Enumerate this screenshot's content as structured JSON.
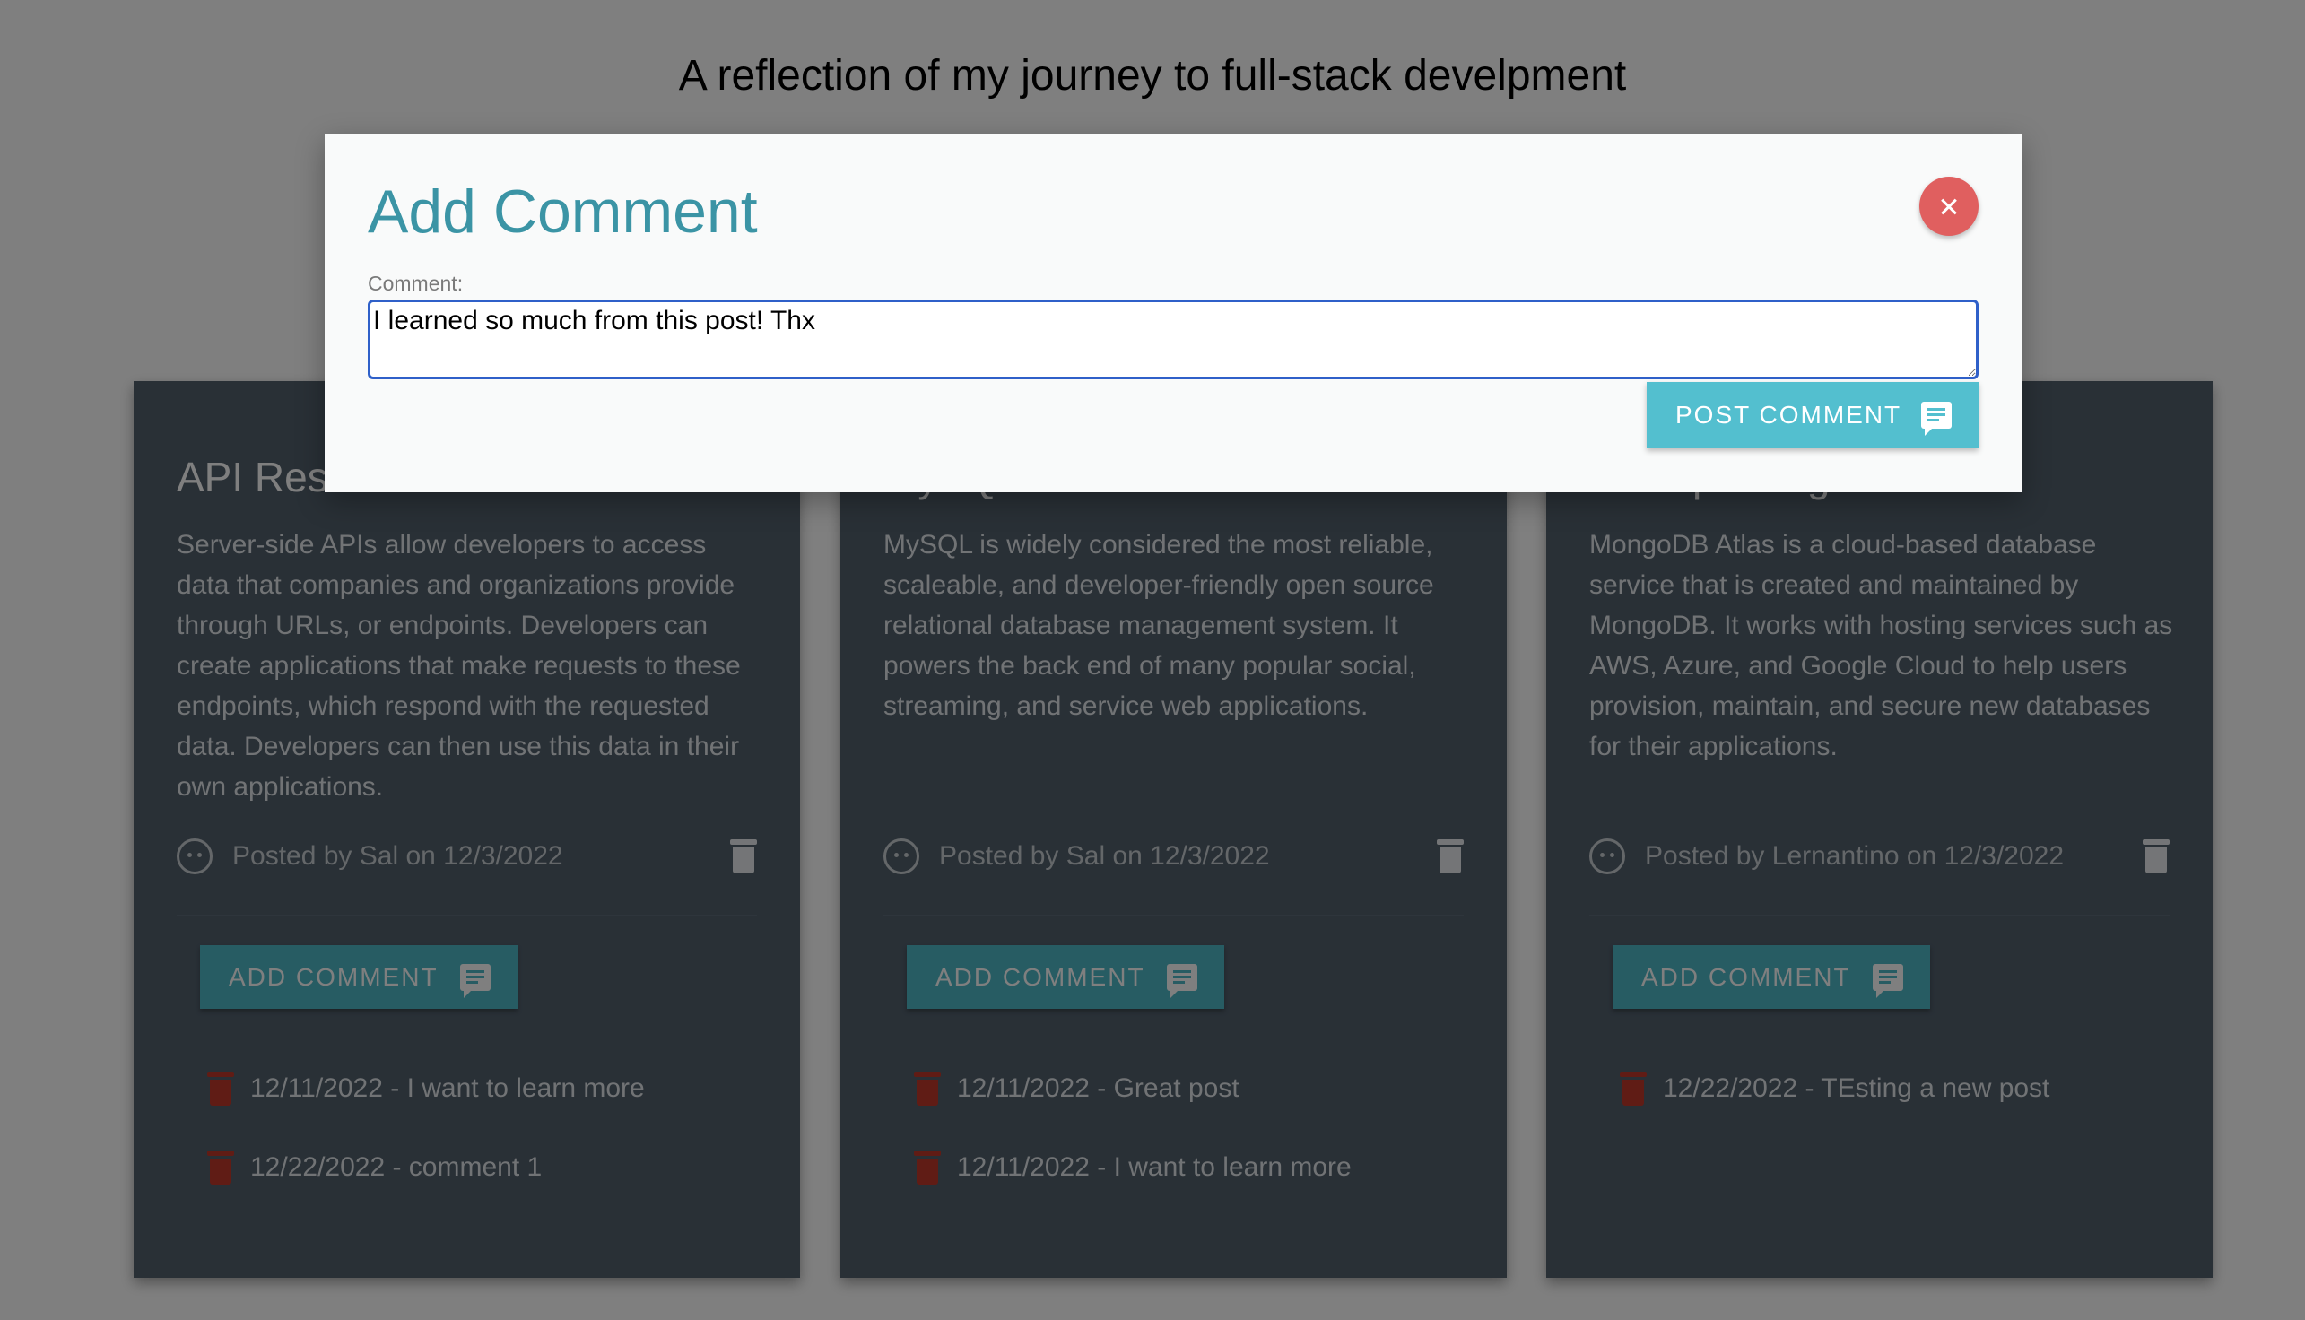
{
  "header": {
    "subtitle": "A reflection of my journey to full-stack develpment"
  },
  "posts": [
    {
      "title": "API Resources",
      "body": "Server-side APIs allow developers to access data that companies and organizations provide through URLs, or endpoints. Developers can create applications that make requests to these endpoints, which respond with the requested data. Developers can then use this data in their own applications.",
      "meta": "Posted by Sal on 12/3/2022",
      "add_comment_label": "ADD COMMENT",
      "comments": [
        "12/11/2022 - I want to learn more",
        "12/22/2022 - comment 1"
      ]
    },
    {
      "title": "MySQL Reference Guide",
      "body": "MySQL is widely considered the most reliable, scaleable, and developer-friendly open source relational database management system. It powers the back end of many popular social, streaming, and service web applications.",
      "meta": "Posted by Sal on 12/3/2022",
      "add_comment_label": "ADD COMMENT",
      "comments": [
        "12/11/2022 - Great post",
        "12/11/2022 - I want to learn more"
      ]
    },
    {
      "title": "Set Up MongoDB Atlas",
      "body": "MongoDB Atlas is a cloud-based database service that is created and maintained by MongoDB. It works with hosting services such as AWS, Azure, and Google Cloud to help users provision, maintain, and secure new databases for their applications.",
      "meta": "Posted by Lernantino on 12/3/2022",
      "add_comment_label": "ADD COMMENT",
      "comments": [
        "12/22/2022 - TEsting a new post"
      ]
    }
  ],
  "modal": {
    "title": "Add Comment",
    "field_label": "Comment:",
    "comment_value": "I learned so much from this post! Thx",
    "submit_label": "POST COMMENT"
  },
  "colors": {
    "accent": "#53bfcf",
    "title": "#3b94a5",
    "close": "#e05f5f",
    "card": "#52606d"
  }
}
